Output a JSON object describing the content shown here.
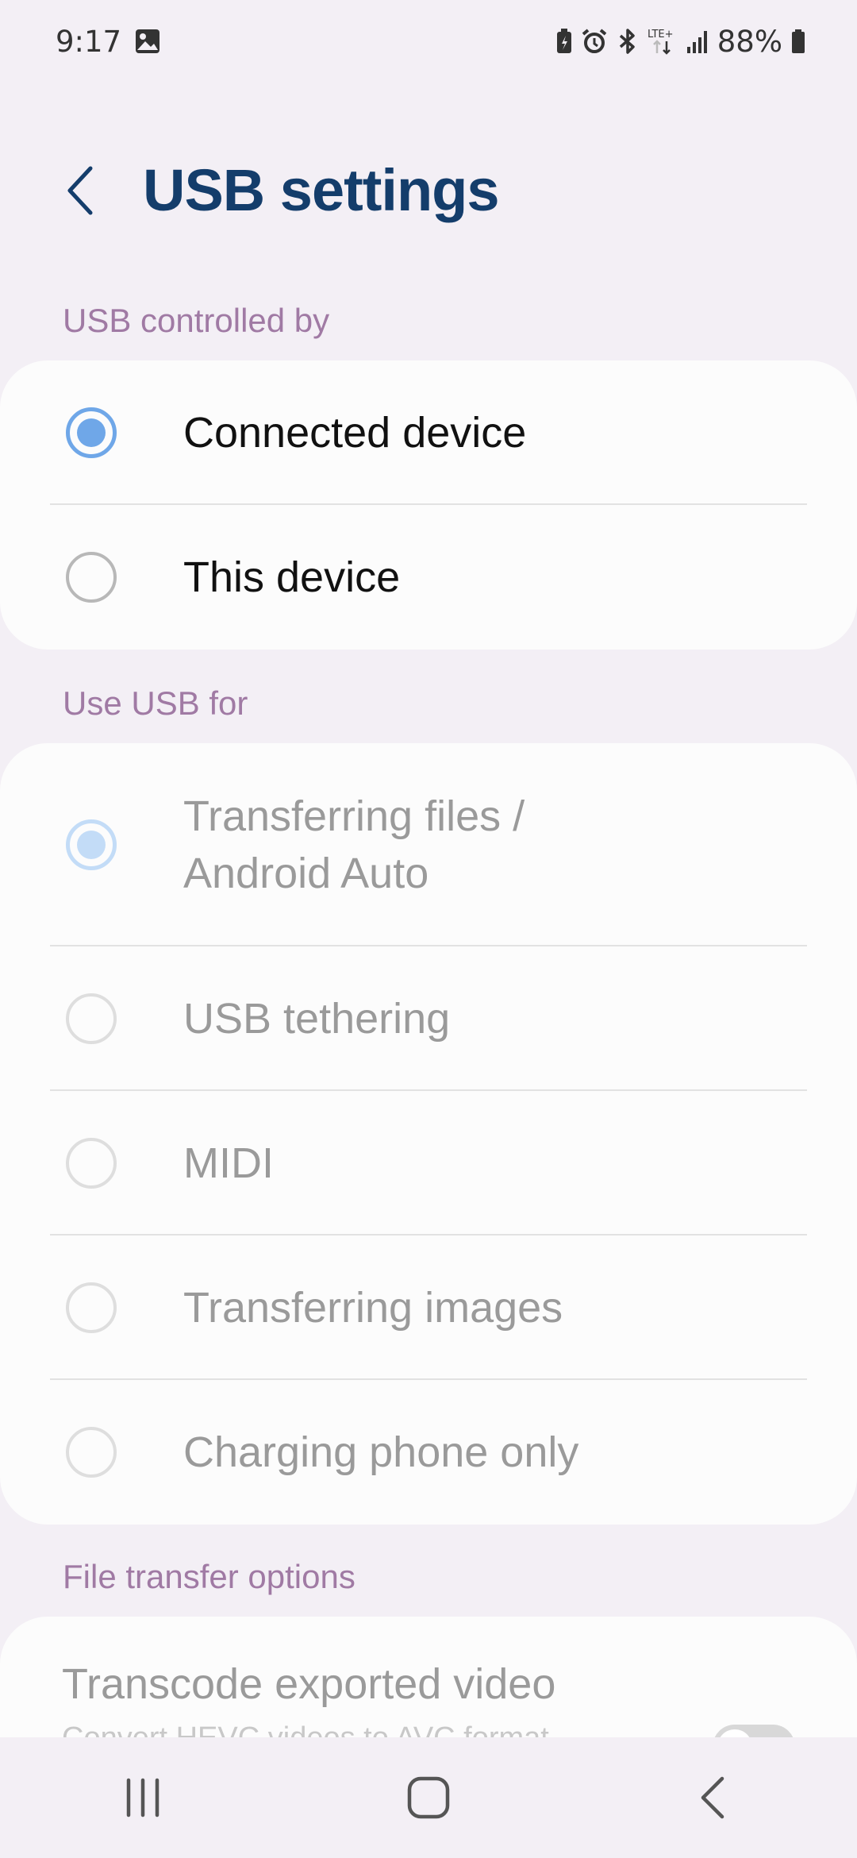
{
  "status_bar": {
    "time": "9:17",
    "battery_percent": "88%",
    "icons": [
      "gallery-icon",
      "battery-saver-icon",
      "alarm-icon",
      "bluetooth-icon",
      "lte-plus-icon",
      "signal-icon",
      "battery-icon"
    ],
    "network_label": "LTE+"
  },
  "header": {
    "title": "USB settings",
    "back_icon": "chevron-left-icon"
  },
  "controlled_by": {
    "label": "USB controlled by",
    "options": [
      {
        "label": "Connected device",
        "selected": true
      },
      {
        "label": "This device",
        "selected": false
      }
    ]
  },
  "use_usb_for": {
    "label": "Use USB for",
    "enabled": false,
    "options": [
      {
        "label": "Transferring files / Android Auto",
        "line1": "Transferring files /",
        "line2": "Android Auto",
        "selected": true
      },
      {
        "label": "USB tethering",
        "selected": false
      },
      {
        "label": "MIDI",
        "selected": false
      },
      {
        "label": "Transferring images",
        "selected": false
      },
      {
        "label": "Charging phone only",
        "selected": false
      }
    ]
  },
  "file_transfer_options": {
    "label": "File transfer options",
    "transcode_title": "Transcode exported video",
    "transcode_subtitle": "Convert HEVC videos to AVC format",
    "transcode_enabled": false
  },
  "nav_bar": {
    "recents": "recents-icon",
    "home": "home-icon",
    "back": "back-icon"
  },
  "colors": {
    "accent": "#6fa7e8",
    "title": "#143d6b",
    "section_label": "#a07aa4",
    "background": "#f3eff5"
  }
}
